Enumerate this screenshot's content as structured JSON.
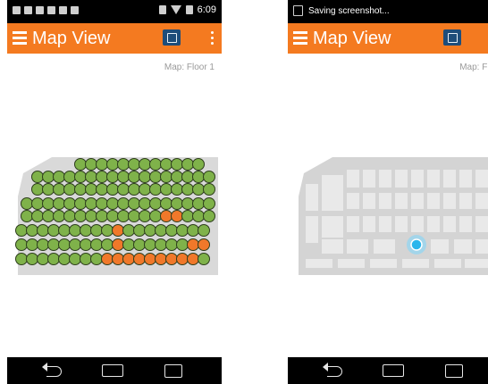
{
  "screens": [
    {
      "status": {
        "time": "6:09"
      },
      "appbar": {
        "title": "Map View"
      },
      "floor_label": "Map: Floor 1"
    },
    {
      "status": {
        "notification": "Saving screenshot..."
      },
      "appbar": {
        "title": "Map View"
      },
      "floor_label": "Map: Floor"
    }
  ],
  "colors": {
    "appbar": "#f47a20",
    "status_bar": "#000000",
    "map_floor": "#d4d4d4",
    "map_room": "#e9e9e9",
    "tree_green": "#7fb24a",
    "tree_orange": "#f0782a",
    "location_dot": "#2bb6ec"
  },
  "icons": {
    "menu": "hamburger-icon",
    "map_toggle": "map-icon",
    "overflow": "more-vert-icon",
    "nav_back": "back-icon",
    "nav_home": "home-icon",
    "nav_recent": "recent-apps-icon"
  }
}
